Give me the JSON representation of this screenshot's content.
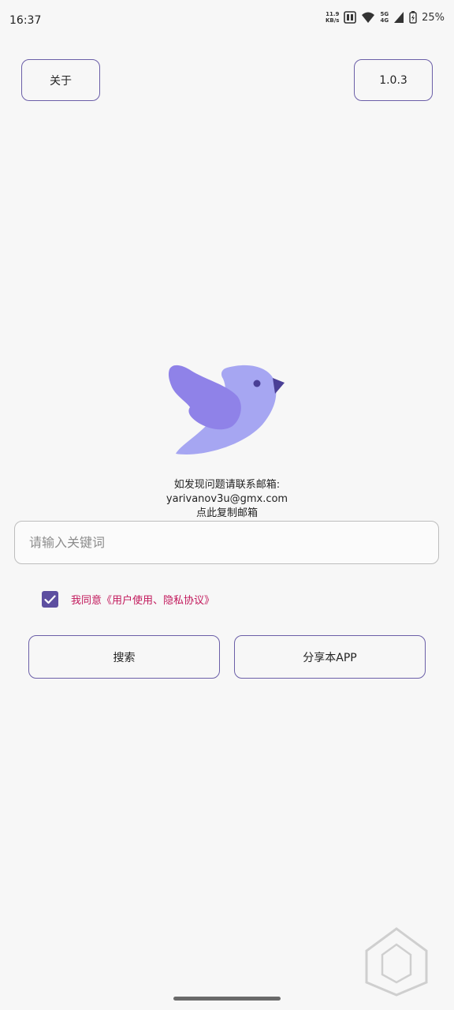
{
  "status_bar": {
    "time": "16:37",
    "net_speed_value": "11.9",
    "net_speed_unit": "KB/s",
    "signal_top": "5G",
    "signal_bottom": "4G",
    "battery": "25%"
  },
  "header": {
    "about_label": "关于",
    "version_label": "1.0.3"
  },
  "logo": {
    "icon": "bird-icon",
    "colors": {
      "body": "#a6a6f2",
      "wing": "#8f82e8",
      "beak": "#4a3f96",
      "eye": "#4a3f96"
    }
  },
  "contact": {
    "line1": "如发现问题请联系邮箱:",
    "email": "yarivanov3u@gmx.com",
    "copy_label": "点此复制邮箱"
  },
  "search": {
    "placeholder": "请输入关键词",
    "value": ""
  },
  "agreement": {
    "checked": true,
    "label": "我同意《用户使用、隐私协议》"
  },
  "actions": {
    "search_label": "搜索",
    "share_label": "分享本APP"
  },
  "colors": {
    "accent": "#5d4fa0",
    "agreement_text": "#c2185b",
    "border": "#6b5fa8",
    "background": "#f7f7f7"
  }
}
